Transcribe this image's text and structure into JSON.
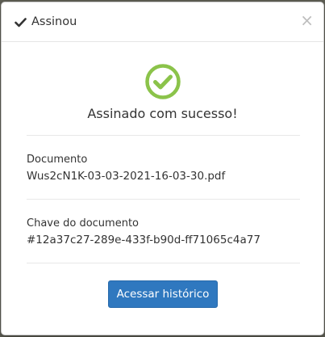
{
  "colors": {
    "accent": "#2f78bf",
    "success": "#8bc34a",
    "backdrop": "#5f5f55"
  },
  "header": {
    "icon": "check-icon",
    "title": "Assinou",
    "close_label": "×",
    "close_icon": "close-icon"
  },
  "status": {
    "icon": "success-check-circle-icon",
    "message": "Assinado com sucesso!"
  },
  "document": {
    "label": "Documento",
    "value": "Wus2cN1K-03-03-2021-16-03-30.pdf"
  },
  "key": {
    "label": "Chave do documento",
    "value": "#12a37c27-289e-433f-b90d-ff71065c4a77"
  },
  "actions": {
    "history_label": "Acessar histórico"
  }
}
